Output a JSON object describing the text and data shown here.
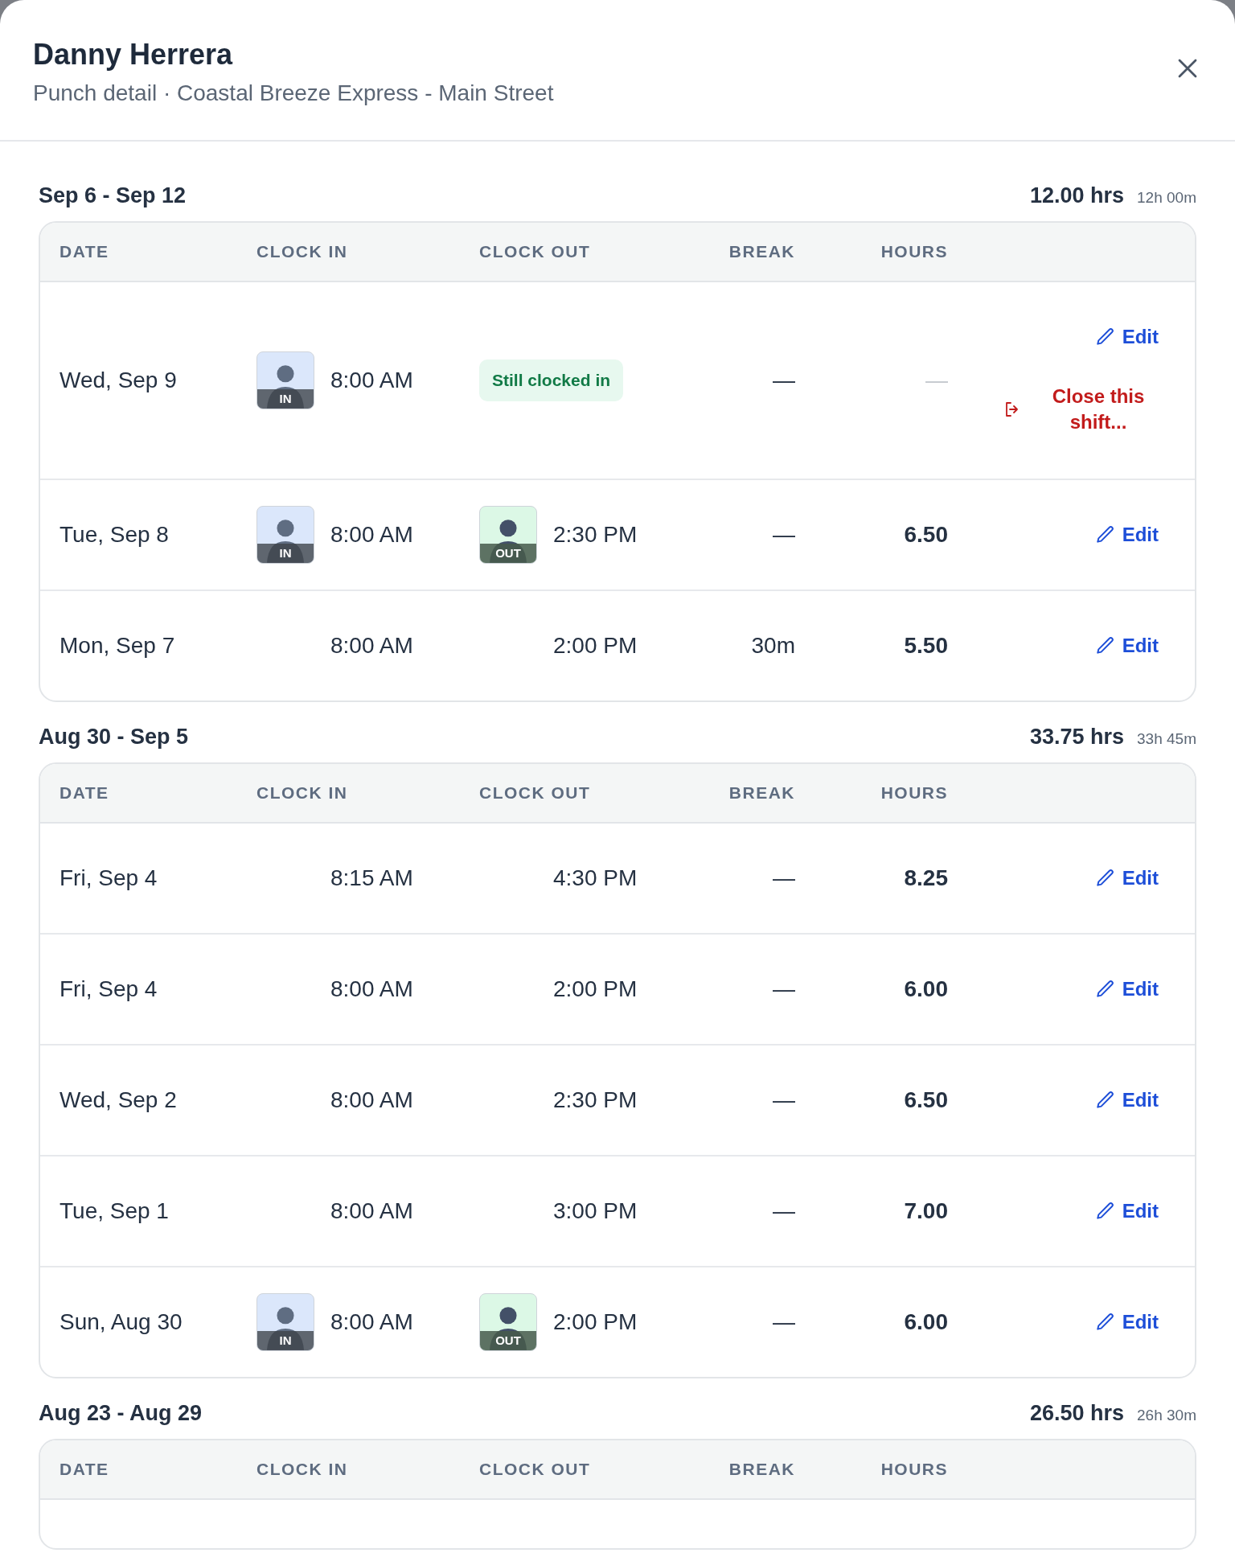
{
  "header": {
    "title": "Danny Herrera",
    "subtitle": "Punch detail · Coastal Breeze Express - Main Street"
  },
  "weeks": [
    {
      "range": "Sep 6 - Sep 12",
      "total": "12.00 hrs",
      "total_short": "12h 00m",
      "columns": [
        "DATE",
        "CLOCK IN",
        "CLOCK OUT",
        "BREAK",
        "HOURS"
      ],
      "rows": [
        {
          "date": "Wed, Sep 9",
          "clock_in": {
            "time": "8:00 AM",
            "photo": {
              "kind": "in",
              "label": "IN"
            }
          },
          "clock_out": {
            "status": "Still clocked in"
          },
          "break": "—",
          "hours": {
            "text": "—",
            "pending": true
          },
          "actions": [
            {
              "kind": "edit",
              "label": "Edit"
            },
            {
              "kind": "close",
              "label": "Close this shift..."
            }
          ]
        },
        {
          "date": "Tue, Sep 8",
          "clock_in": {
            "time": "8:00 AM",
            "photo": {
              "kind": "in",
              "label": "IN"
            }
          },
          "clock_out": {
            "time": "2:30 PM",
            "photo": {
              "kind": "out",
              "label": "OUT"
            }
          },
          "break": "—",
          "hours": {
            "text": "6.50",
            "pending": false
          },
          "actions": [
            {
              "kind": "edit",
              "label": "Edit"
            }
          ]
        },
        {
          "date": "Mon, Sep 7",
          "clock_in": {
            "time": "8:00 AM"
          },
          "clock_out": {
            "time": "2:00 PM"
          },
          "break": "30m",
          "hours": {
            "text": "5.50",
            "pending": false
          },
          "actions": [
            {
              "kind": "edit",
              "label": "Edit"
            }
          ]
        }
      ]
    },
    {
      "range": "Aug 30 - Sep 5",
      "total": "33.75 hrs",
      "total_short": "33h 45m",
      "columns": [
        "DATE",
        "CLOCK IN",
        "CLOCK OUT",
        "BREAK",
        "HOURS"
      ],
      "rows": [
        {
          "date": "Fri, Sep 4",
          "clock_in": {
            "time": "8:15 AM"
          },
          "clock_out": {
            "time": "4:30 PM"
          },
          "break": "—",
          "hours": {
            "text": "8.25",
            "pending": false
          },
          "actions": [
            {
              "kind": "edit",
              "label": "Edit"
            }
          ]
        },
        {
          "date": "Fri, Sep 4",
          "clock_in": {
            "time": "8:00 AM"
          },
          "clock_out": {
            "time": "2:00 PM"
          },
          "break": "—",
          "hours": {
            "text": "6.00",
            "pending": false
          },
          "actions": [
            {
              "kind": "edit",
              "label": "Edit"
            }
          ]
        },
        {
          "date": "Wed, Sep 2",
          "clock_in": {
            "time": "8:00 AM"
          },
          "clock_out": {
            "time": "2:30 PM"
          },
          "break": "—",
          "hours": {
            "text": "6.50",
            "pending": false
          },
          "actions": [
            {
              "kind": "edit",
              "label": "Edit"
            }
          ]
        },
        {
          "date": "Tue, Sep 1",
          "clock_in": {
            "time": "8:00 AM"
          },
          "clock_out": {
            "time": "3:00 PM"
          },
          "break": "—",
          "hours": {
            "text": "7.00",
            "pending": false
          },
          "actions": [
            {
              "kind": "edit",
              "label": "Edit"
            }
          ]
        },
        {
          "date": "Sun, Aug 30",
          "clock_in": {
            "time": "8:00 AM",
            "photo": {
              "kind": "in",
              "label": "IN"
            }
          },
          "clock_out": {
            "time": "2:00 PM",
            "photo": {
              "kind": "out",
              "label": "OUT"
            }
          },
          "break": "—",
          "hours": {
            "text": "6.00",
            "pending": false
          },
          "actions": [
            {
              "kind": "edit",
              "label": "Edit"
            }
          ]
        }
      ]
    },
    {
      "range": "Aug 23 - Aug 29",
      "total": "26.50 hrs",
      "total_short": "26h 30m",
      "columns": [
        "DATE",
        "CLOCK IN",
        "CLOCK OUT",
        "BREAK",
        "HOURS"
      ]
    }
  ]
}
